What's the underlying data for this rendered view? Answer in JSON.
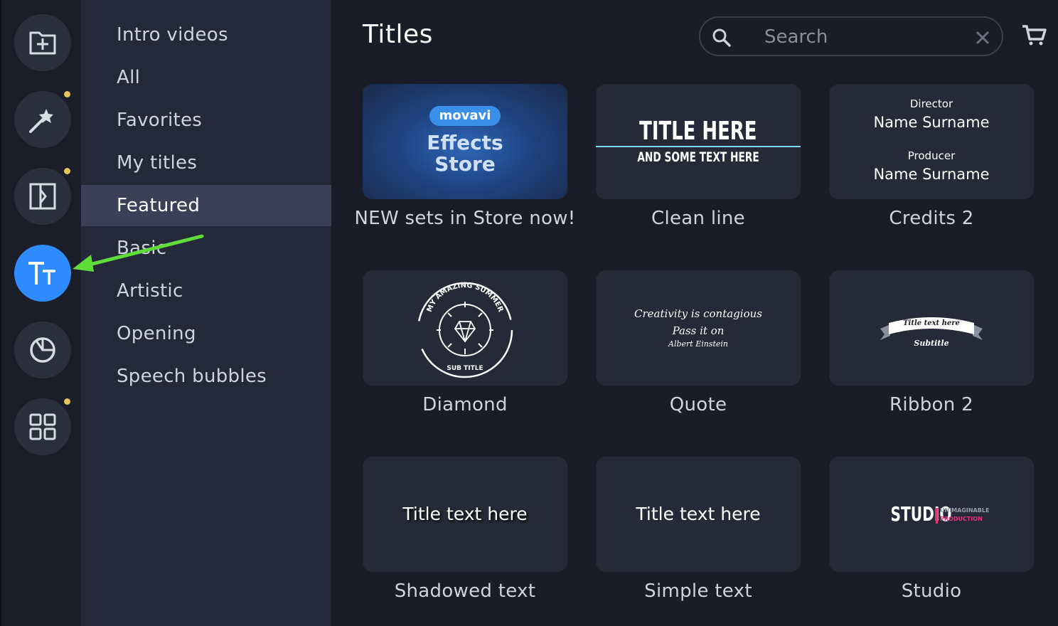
{
  "rail": {
    "icons": [
      "import-icon",
      "magic-wand-icon",
      "transitions-icon",
      "titles-icon",
      "stickers-icon",
      "more-tools-icon"
    ]
  },
  "categories": {
    "items": [
      "Intro videos",
      "All",
      "Favorites",
      "My titles",
      "Featured",
      "Basic",
      "Artistic",
      "Opening",
      "Speech bubbles"
    ],
    "selected": "Featured"
  },
  "header": {
    "title": "Titles",
    "search_placeholder": "Search"
  },
  "cards": {
    "store": {
      "badge": "movavi",
      "line1": "Effects",
      "line2": "Store",
      "label": "NEW sets in Store now!"
    },
    "clean_line": {
      "big": "TITLE HERE",
      "small": "AND SOME TEXT HERE",
      "label": "Clean line"
    },
    "credits": {
      "role1": "Director",
      "name1": "Name Surname",
      "role2": "Producer",
      "name2": "Name Surname",
      "label": "Credits 2"
    },
    "diamond": {
      "arc": "MY AMAZING SUMMER",
      "sub": "SUB TITLE",
      "label": "Diamond"
    },
    "quote": {
      "line1": "Creativity is contagious",
      "line2": "Pass it on",
      "line3": "Albert Einstein",
      "label": "Quote"
    },
    "ribbon": {
      "banner": "Title text here",
      "sub": "Subtitle",
      "label": "Ribbon 2"
    },
    "shadowed": {
      "text": "Title text here",
      "label": "Shadowed text"
    },
    "simple": {
      "text": "Title text here",
      "label": "Simple text"
    },
    "studio": {
      "word": "STUDIO",
      "tag1": "UNIMAGINABLE",
      "tag2": "PRODUCTION",
      "label": "Studio"
    }
  },
  "colors": {
    "accent": "#2f8cff",
    "arrow": "#5fdc3a",
    "dot": "#e7c35a",
    "studio_pink": "#e8327a"
  }
}
